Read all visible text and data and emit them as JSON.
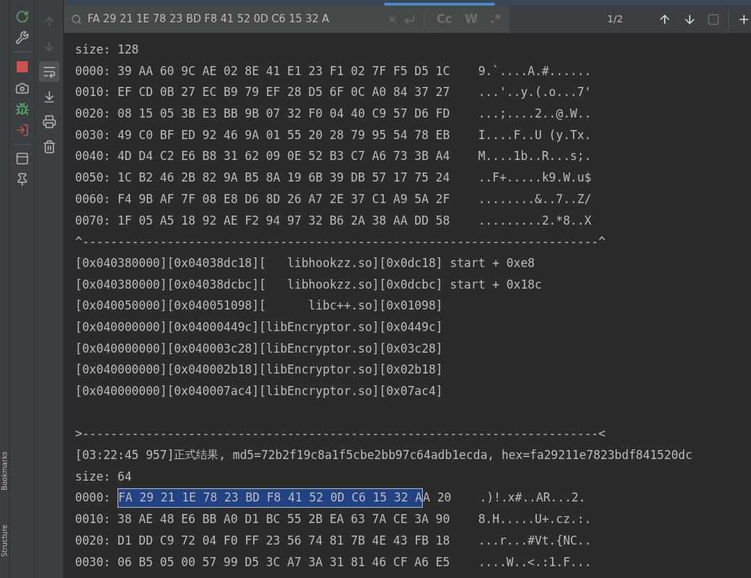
{
  "side_labels": [
    "Bookmarks",
    "Structure"
  ],
  "run_toolbar": [
    {
      "kind": "rerun"
    },
    {
      "kind": "settings"
    },
    {
      "kind": "divider"
    },
    {
      "kind": "stop"
    },
    {
      "kind": "camera"
    },
    {
      "kind": "bug"
    },
    {
      "kind": "exit"
    },
    {
      "kind": "divider"
    },
    {
      "kind": "layout"
    },
    {
      "kind": "pin"
    }
  ],
  "console_toolbar": [
    {
      "kind": "up",
      "disabled": true,
      "selected": false
    },
    {
      "kind": "down",
      "disabled": true,
      "selected": false
    },
    {
      "kind": "wrap",
      "disabled": false,
      "selected": true
    },
    {
      "kind": "scroll_end",
      "disabled": false,
      "selected": false
    },
    {
      "kind": "print",
      "disabled": false,
      "selected": false
    },
    {
      "kind": "trash",
      "disabled": false,
      "selected": false
    }
  ],
  "search": {
    "query": "FA 29 21 1E 78 23 BD F8 41 52 0D C6 15 32 A",
    "options": [
      {
        "label": "Cc",
        "on": false
      },
      {
        "label": "W",
        "on": false
      },
      {
        "label": ".*",
        "on": false
      }
    ],
    "match_count": "1/2"
  },
  "console_lines": [
    {
      "kind": "text",
      "text": "size: 128"
    },
    {
      "kind": "text",
      "text": "0000: 39 AA 60 9C AE 02 8E 41 E1 23 F1 02 7F F5 D5 1C    9.`....A.#......"
    },
    {
      "kind": "text",
      "text": "0010: EF CD 0B 27 EC B9 79 EF 28 D5 6F 0C A0 84 37 27    ...'..y.(.o...7'"
    },
    {
      "kind": "text",
      "text": "0020: 08 15 05 3B E3 BB 9B 07 32 F0 04 40 C9 57 D6 FD    ...;....2..@.W.."
    },
    {
      "kind": "text",
      "text": "0030: 49 C0 BF ED 92 46 9A 01 55 20 28 79 95 54 78 EB    I....F..U (y.Tx."
    },
    {
      "kind": "text",
      "text": "0040: 4D D4 C2 E6 B8 31 62 09 0E 52 B3 C7 A6 73 3B A4    M....1b..R...s;."
    },
    {
      "kind": "text",
      "text": "0050: 1C B2 46 2B 82 9A B5 8A 19 6B 39 DB 57 17 75 24    ..F+.....k9.W.u$"
    },
    {
      "kind": "text",
      "text": "0060: F4 9B AF 7F 08 E8 D6 8D 26 A7 2E 37 C1 A9 5A 2F    ........&..7..Z/"
    },
    {
      "kind": "text",
      "text": "0070: 1F 05 A5 18 92 AE F2 94 97 32 B6 2A 38 AA DD 58    .........2.*8..X"
    },
    {
      "kind": "text",
      "text": "^-------------------------------------------------------------------------^"
    },
    {
      "kind": "text",
      "text": "[0x040380000][0x04038dc18][   libhookzz.so][0x0dc18] start + 0xe8"
    },
    {
      "kind": "text",
      "text": "[0x040380000][0x04038dcbc][   libhookzz.so][0x0dcbc] start + 0x18c"
    },
    {
      "kind": "text",
      "text": "[0x040050000][0x040051098][      libc++.so][0x01098]"
    },
    {
      "kind": "text",
      "text": "[0x040000000][0x04000449c][libEncryptor.so][0x0449c]"
    },
    {
      "kind": "text",
      "text": "[0x040000000][0x040003c28][libEncryptor.so][0x03c28]"
    },
    {
      "kind": "text",
      "text": "[0x040000000][0x040002b18][libEncryptor.so][0x02b18]"
    },
    {
      "kind": "text",
      "text": "[0x040000000][0x040007ac4][libEncryptor.so][0x07ac4]"
    },
    {
      "kind": "blank"
    },
    {
      "kind": "text",
      "text": ">-------------------------------------------------------------------------<"
    },
    {
      "kind": "mixed",
      "time": "[03:22:45 957]",
      "label": "正式结果",
      "text": ", md5=72b2f19c8a1f5cbe2bb97c64adb1ecda, hex=fa29211e7823bdf841520dc"
    },
    {
      "kind": "text",
      "text": "size: 64"
    },
    {
      "kind": "match",
      "before": "0000: ",
      "match": "FA 29 21 1E 78 23 BD F8 41 52 0D C6 15 32 A",
      "after": "A 20    .)!.x#..AR...2."
    },
    {
      "kind": "text",
      "text": "0010: 38 AE 48 E6 BB A0 D1 BC 55 2B EA 63 7A CE 3A 90    8.H.....U+.cz.:."
    },
    {
      "kind": "text",
      "text": "0020: D1 DD C9 72 04 F0 FF 23 56 74 81 7B 4E 43 FB 18    ...r...#Vt.{NC.."
    },
    {
      "kind": "text",
      "text": "0030: 06 B5 05 00 57 99 D5 3C A7 3A 31 81 46 CF A6 E5    ....W..<.:1.F..."
    }
  ]
}
